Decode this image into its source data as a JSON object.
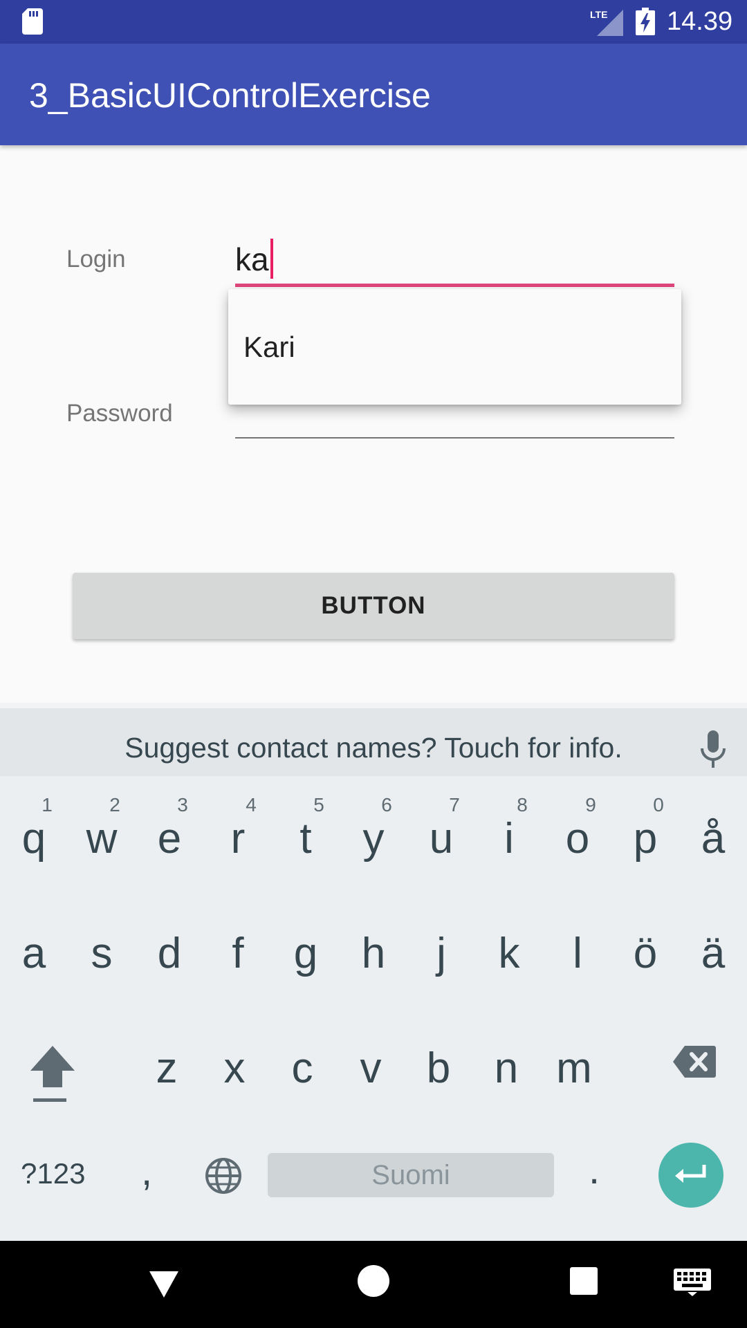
{
  "status_bar": {
    "network": "LTE",
    "time": "14.39"
  },
  "app_bar": {
    "title": "3_BasicUIControlExercise"
  },
  "form": {
    "login_label": "Login",
    "login_value": "ka",
    "password_label": "Password",
    "password_value": "",
    "autocomplete_suggestions": [
      "Kari"
    ],
    "button_label": "BUTTON"
  },
  "keyboard": {
    "suggestion_strip_text": "Suggest contact names? Touch for info.",
    "row1": [
      {
        "key": "q",
        "hint": "1"
      },
      {
        "key": "w",
        "hint": "2"
      },
      {
        "key": "e",
        "hint": "3"
      },
      {
        "key": "r",
        "hint": "4"
      },
      {
        "key": "t",
        "hint": "5"
      },
      {
        "key": "y",
        "hint": "6"
      },
      {
        "key": "u",
        "hint": "7"
      },
      {
        "key": "i",
        "hint": "8"
      },
      {
        "key": "o",
        "hint": "9"
      },
      {
        "key": "p",
        "hint": "0"
      },
      {
        "key": "å",
        "hint": ""
      }
    ],
    "row2": [
      "a",
      "s",
      "d",
      "f",
      "g",
      "h",
      "j",
      "k",
      "l",
      "ö",
      "ä"
    ],
    "row3": [
      "z",
      "x",
      "c",
      "v",
      "b",
      "n",
      "m"
    ],
    "symbols_label": "?123",
    "comma_label": ",",
    "space_label": "Suomi",
    "period_label": ".",
    "accent_color": "#4db6ac"
  },
  "colors": {
    "status_bar": "#303f9f",
    "app_bar": "#3f51b5",
    "focus_underline": "#e0457b"
  }
}
